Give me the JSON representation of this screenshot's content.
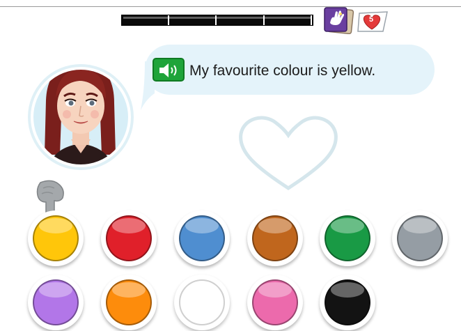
{
  "progress": {
    "segments_total": 4,
    "segments_filled": 4
  },
  "lives": {
    "count": "5",
    "icon": "heart-icon"
  },
  "card": {
    "icon": "hand-sign-card-icon",
    "color": "#6a3fa0"
  },
  "speech": {
    "text": "My favourite colour is yellow.",
    "audio_icon": "speaker-icon"
  },
  "target": {
    "icon": "heart-outline-icon",
    "color": "#ffffff"
  },
  "hint": {
    "icon": "pointing-hand-icon"
  },
  "swatches": [
    {
      "name": "yellow",
      "color": "#ffc60a"
    },
    {
      "name": "red",
      "color": "#e0202a"
    },
    {
      "name": "blue",
      "color": "#4f8ed0"
    },
    {
      "name": "brown",
      "color": "#c0661d"
    },
    {
      "name": "green",
      "color": "#199a45"
    },
    {
      "name": "grey",
      "color": "#959da4"
    },
    {
      "name": "purple",
      "color": "#b276e8"
    },
    {
      "name": "orange",
      "color": "#fd8c0c"
    },
    {
      "name": "white",
      "color": "#ffffff"
    },
    {
      "name": "pink",
      "color": "#ec6aac"
    },
    {
      "name": "black",
      "color": "#131313"
    }
  ]
}
